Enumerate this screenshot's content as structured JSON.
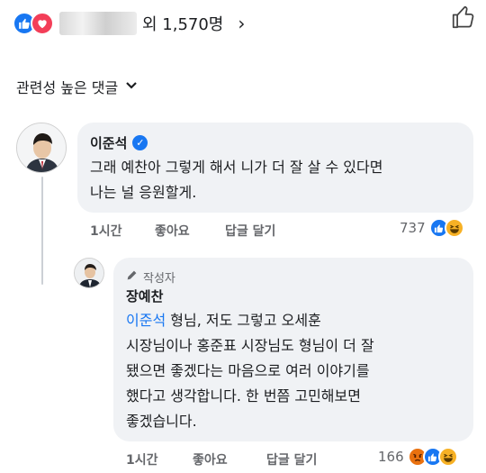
{
  "top_reactions": {
    "name_suffix": "외 1,570명",
    "chevron": "›",
    "icons": [
      "like-icon",
      "love-icon"
    ]
  },
  "sort": {
    "label": "관련성 높은 댓글",
    "chevron": "⌄"
  },
  "comment1": {
    "author": "이준석",
    "verified": "✓",
    "text_line1": "그래 예찬아 그렇게 해서 니가 더 잘 살 수 있다면",
    "text_line2": "나는 널 응원할게.",
    "time": "1시간",
    "like": "좋아요",
    "reply": "답글 달기",
    "reaction_count": "737",
    "reaction_icons": [
      "like-icon",
      "haha-icon"
    ]
  },
  "comment2": {
    "badge": "작성자",
    "author": "장예찬",
    "mention": "이준석",
    "text_line1_rest": " 형님, 저도 그렇고 오세훈",
    "text_line2": "시장님이나 홍준표 시장님도 형님이 더 잘",
    "text_line3": "됐으면 좋겠다는 마음으로 여러 이야기를",
    "text_line4": "했다고 생각합니다. 한 번쯤 고민해보면",
    "text_line5": "좋겠습니다.",
    "time": "1시간",
    "like": "좋아요",
    "reply": "답글 달기",
    "reaction_count": "166",
    "reaction_icons": [
      "angry-icon",
      "like-icon",
      "haha-icon"
    ]
  },
  "colors": {
    "facebook_blue": "#1877f2",
    "bubble_bg": "#f0f2f5",
    "secondary_text": "#65676b"
  }
}
